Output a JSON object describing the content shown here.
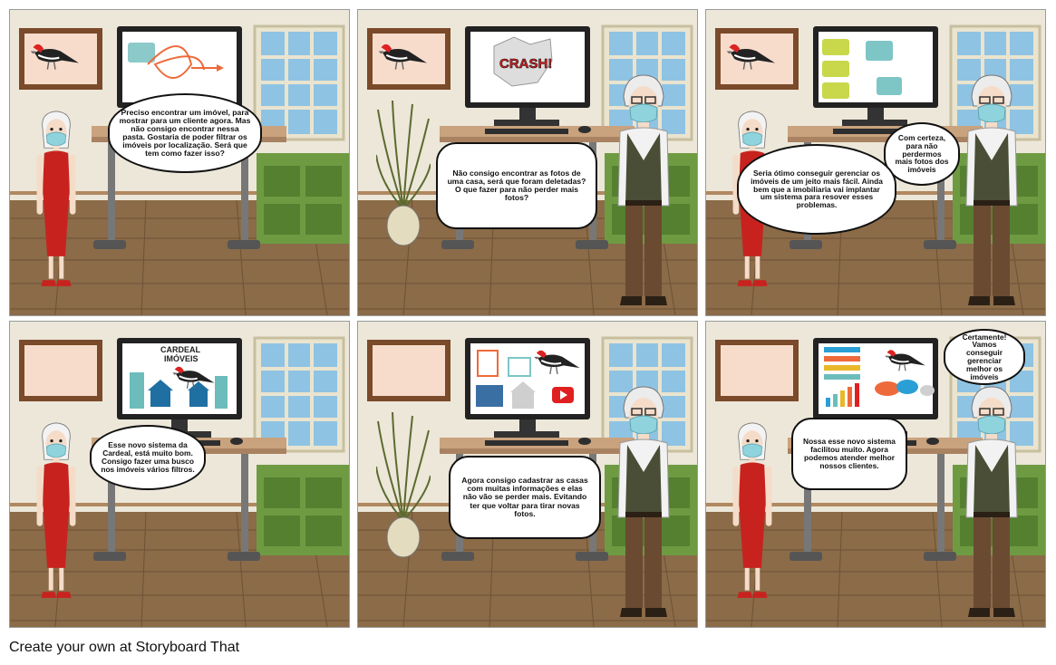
{
  "panels": [
    {
      "bubbles": [
        "Preciso encontrar um imóvel, para mostrar para um cliente agora. Mas não consigo encontrar nessa pasta. Gostaria de poder filtrar os imóveis por localização. Será que tem como fazer isso?"
      ]
    },
    {
      "bubbles": [
        "Não consigo encontrar as fotos de uma casa, será que foram deletadas? O que fazer para não perder mais fotos?"
      ],
      "screen_text": "CRASH!"
    },
    {
      "bubbles": [
        "Com certeza, para não perdermos mais fotos dos imóveis",
        "Seria ótimo conseguir gerenciar os imóveis de um jeito mais fácil. Ainda bem que a imobiliaria vai implantar um sistema para resover esses problemas."
      ]
    },
    {
      "bubbles": [
        "Esse novo sistema da Cardeal, está muito bom. Consigo fazer uma busco nos imóveis vários filtros."
      ],
      "screen_text": "CARDEAL IMÓVEIS"
    },
    {
      "bubbles": [
        "Agora consigo cadastrar as casas com muitas informações e elas não vão se perder mais. Evitando ter que voltar para tirar novas fotos."
      ]
    },
    {
      "bubbles": [
        "Certamente! Vamos conseguir gerenciar melhor os imóveis",
        "Nossa esse novo sistema facilitou muito. Agora podemos atender melhor nossos clientes."
      ]
    }
  ],
  "footer": "Create your own at Storyboard That",
  "colors": {
    "wall": "#ede8dc",
    "floor": "#8a6a48",
    "desk": "#c9a27e",
    "shelf": "#6f9a45",
    "dress": "#c8221e",
    "vest": "#4a4e36",
    "mask": "#8fd3dd"
  }
}
